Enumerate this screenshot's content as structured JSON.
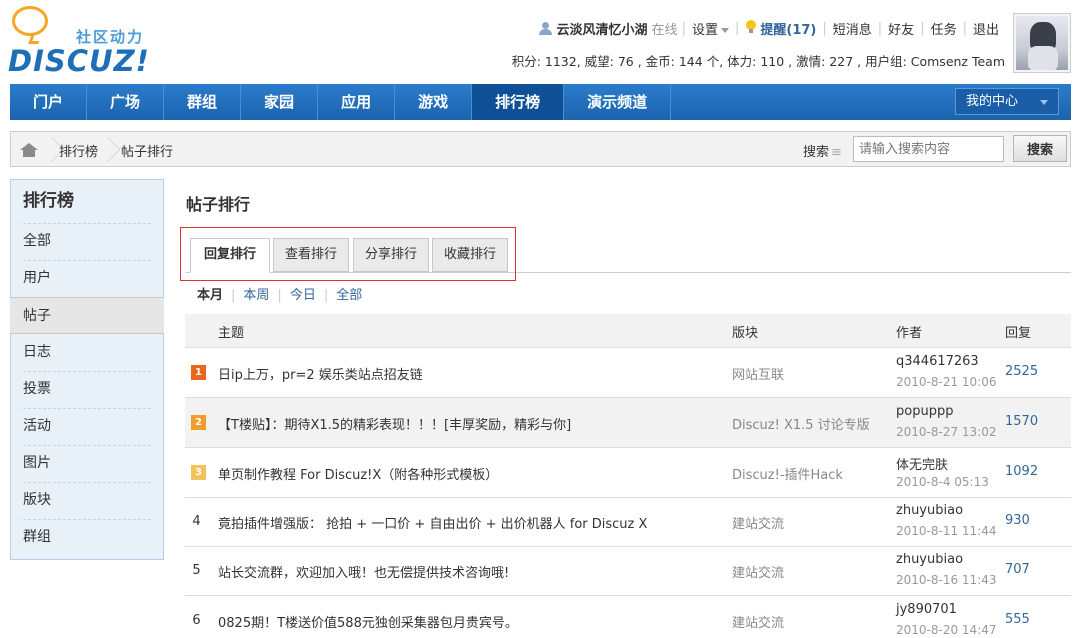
{
  "header": {
    "logo": {
      "slogan": "社区动力",
      "brand": "DISCUZ!"
    },
    "user": {
      "username": "云淡风清忆小湖",
      "status": "在线",
      "settings": "设置",
      "remind": "提醒(17)",
      "messages": "短消息",
      "friends": "好友",
      "tasks": "任务",
      "logout": "退出"
    },
    "stats": "积分: 1132, 威望: 76 , 金币: 144 个, 体力: 110 , 激情: 227 , 用户组: Comsenz Team"
  },
  "nav": {
    "items": [
      "门户",
      "广场",
      "群组",
      "家园",
      "应用",
      "游戏",
      "排行榜",
      "演示频道"
    ],
    "active": "排行榜",
    "my_center": "我的中心"
  },
  "breadcrumb": {
    "items": [
      "排行榜",
      "帖子排行"
    ]
  },
  "search": {
    "label": "搜索",
    "placeholder": "请输入搜索内容",
    "button": "搜索"
  },
  "sidebar": {
    "title": "排行榜",
    "items": [
      "全部",
      "用户",
      "帖子",
      "日志",
      "投票",
      "活动",
      "图片",
      "版块",
      "群组"
    ],
    "active": "帖子"
  },
  "main": {
    "title": "帖子排行",
    "tabs": [
      "回复排行",
      "查看排行",
      "分享排行",
      "收藏排行"
    ],
    "active_tab": "回复排行",
    "periods": [
      "本月",
      "本周",
      "今日",
      "全部"
    ],
    "active_period": "本月",
    "columns": {
      "subject": "主题",
      "forum": "版块",
      "author": "作者",
      "replies": "回复"
    },
    "rows": [
      {
        "rank": "1",
        "subject": "日ip上万，pr=2 娱乐类站点招友链",
        "forum": "网站互联",
        "author": "q344617263",
        "date": "2010-8-21 10:06",
        "replies": "2525"
      },
      {
        "rank": "2",
        "subject": "【T楼贴】：期待X1.5的精彩表现！！！[丰厚奖励，精彩与你]",
        "forum": "Discuz! X1.5 讨论专版",
        "author": "popuppp",
        "date": "2010-8-27 13:02",
        "replies": "1570"
      },
      {
        "rank": "3",
        "subject": "单页制作教程 For Discuz!X（附各种形式模板）",
        "forum": "Discuz!-插件Hack",
        "author": "体无完肤",
        "date": "2010-8-4 05:13",
        "replies": "1092"
      },
      {
        "rank": "4",
        "subject": "竟拍插件增强版： 抢拍 + 一口价 + 自由出价 + 出价机器人 for Discuz X",
        "forum": "建站交流",
        "author": "zhuyubiao",
        "date": "2010-8-11 11:44",
        "replies": "930"
      },
      {
        "rank": "5",
        "subject": "站长交流群，欢迎加入哦！也无偿提供技术咨询哦!",
        "forum": "建站交流",
        "author": "zhuyubiao",
        "date": "2010-8-16 11:43",
        "replies": "707"
      },
      {
        "rank": "6",
        "subject": "0825期！T楼送价值588元独创采集器包月贵宾号。",
        "forum": "建站交流",
        "author": "jy890701",
        "date": "2010-8-20 14:47",
        "replies": "555"
      }
    ]
  },
  "colors": {
    "nav_bg": "#1b63ad",
    "nav_active": "#0f4f95",
    "link": "#336699",
    "highlight_border": "#e03131"
  }
}
